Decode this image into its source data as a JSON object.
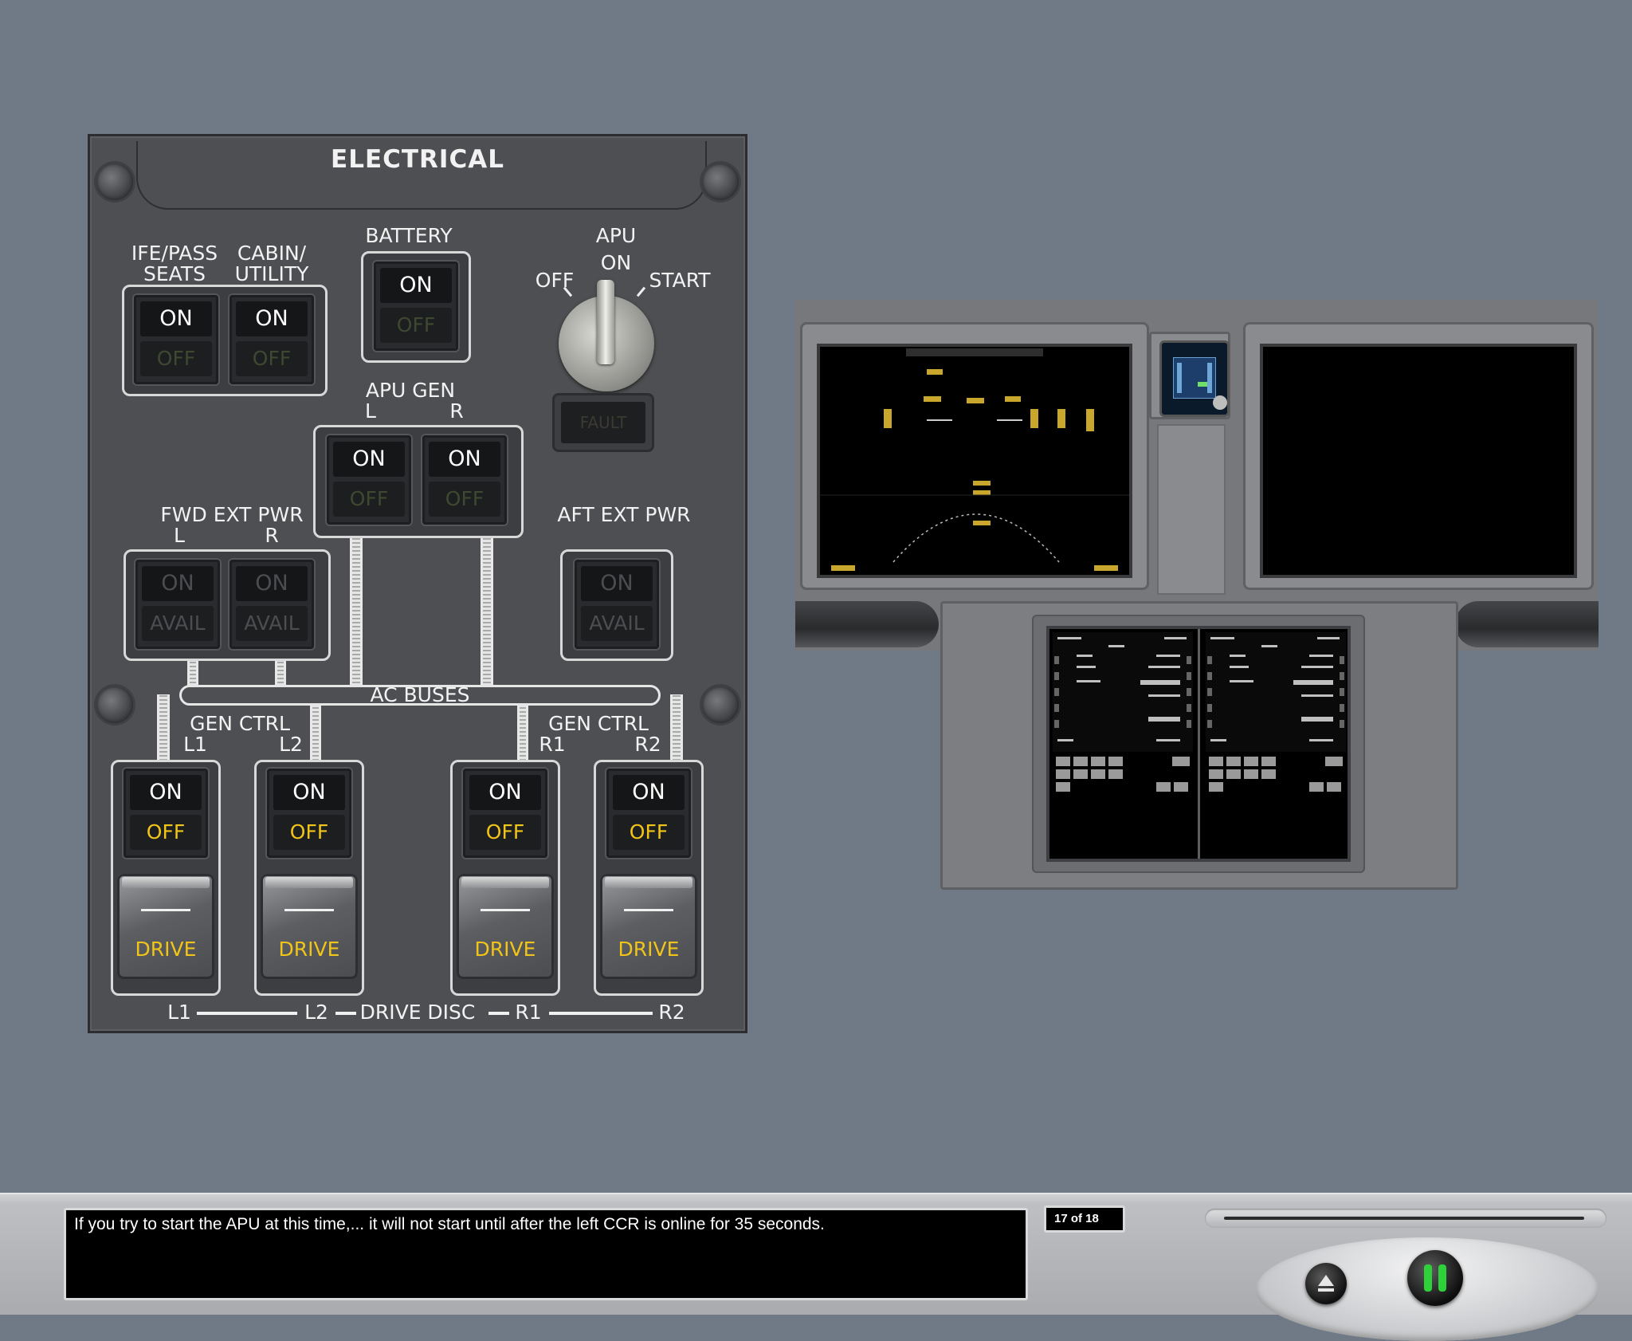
{
  "panel": {
    "title": "ELECTRICAL",
    "ife_label": "IFE/PASS\nSEATS",
    "cabin_label": "CABIN/\nUTILITY",
    "battery_label": "BATTERY",
    "apu_label": "APU",
    "apu_positions": {
      "off": "OFF",
      "on": "ON",
      "start": "START"
    },
    "apu_fault": "FAULT",
    "apu_gen_label": "APU GEN",
    "left": "L",
    "right": "R",
    "fwd_ext_label": "FWD EXT PWR",
    "aft_ext_label": "AFT EXT PWR",
    "ac_buses": "AC BUSES",
    "gen_ctrl_label": "GEN CTRL",
    "l1": "L1",
    "l2": "L2",
    "r1": "R1",
    "r2": "R2",
    "on": "ON",
    "off": "OFF",
    "avail": "AVAIL",
    "drive": "DRIVE",
    "drive_disc": "DRIVE DISC"
  },
  "player": {
    "caption": "If you try to start the APU at this time,... it will not start until after the left CCR is online for 35 seconds.",
    "pager": "17 of 18",
    "progress": 0.0
  },
  "colors": {
    "background": "#6f7a86",
    "amber": "#f0c419",
    "panel": "#4e4f52"
  },
  "icons": {
    "eject": "eject-icon",
    "pause": "pause-icon"
  }
}
